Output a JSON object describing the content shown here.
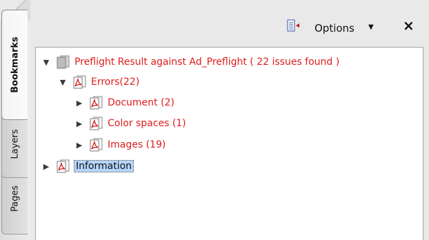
{
  "tabs": [
    {
      "label": "Bookmarks",
      "active": true
    },
    {
      "label": "Layers",
      "active": false
    },
    {
      "label": "Pages",
      "active": false
    }
  ],
  "toolbar": {
    "options_label": "Options",
    "options_caret": "▼",
    "close_label": "×"
  },
  "tree": {
    "root": {
      "label": "Preflight Result against Ad_Preflight ( 22 issues found )",
      "expanded": true
    },
    "errors": {
      "label": "Errors(22)",
      "expanded": true
    },
    "children": [
      {
        "label": "Document (2)"
      },
      {
        "label": "Color spaces (1)"
      },
      {
        "label": "Images (19)"
      }
    ],
    "information": {
      "label": "Information",
      "selected": true
    }
  },
  "colors": {
    "issue_text": "#e01b1b",
    "selection": "#b5d5ff"
  }
}
